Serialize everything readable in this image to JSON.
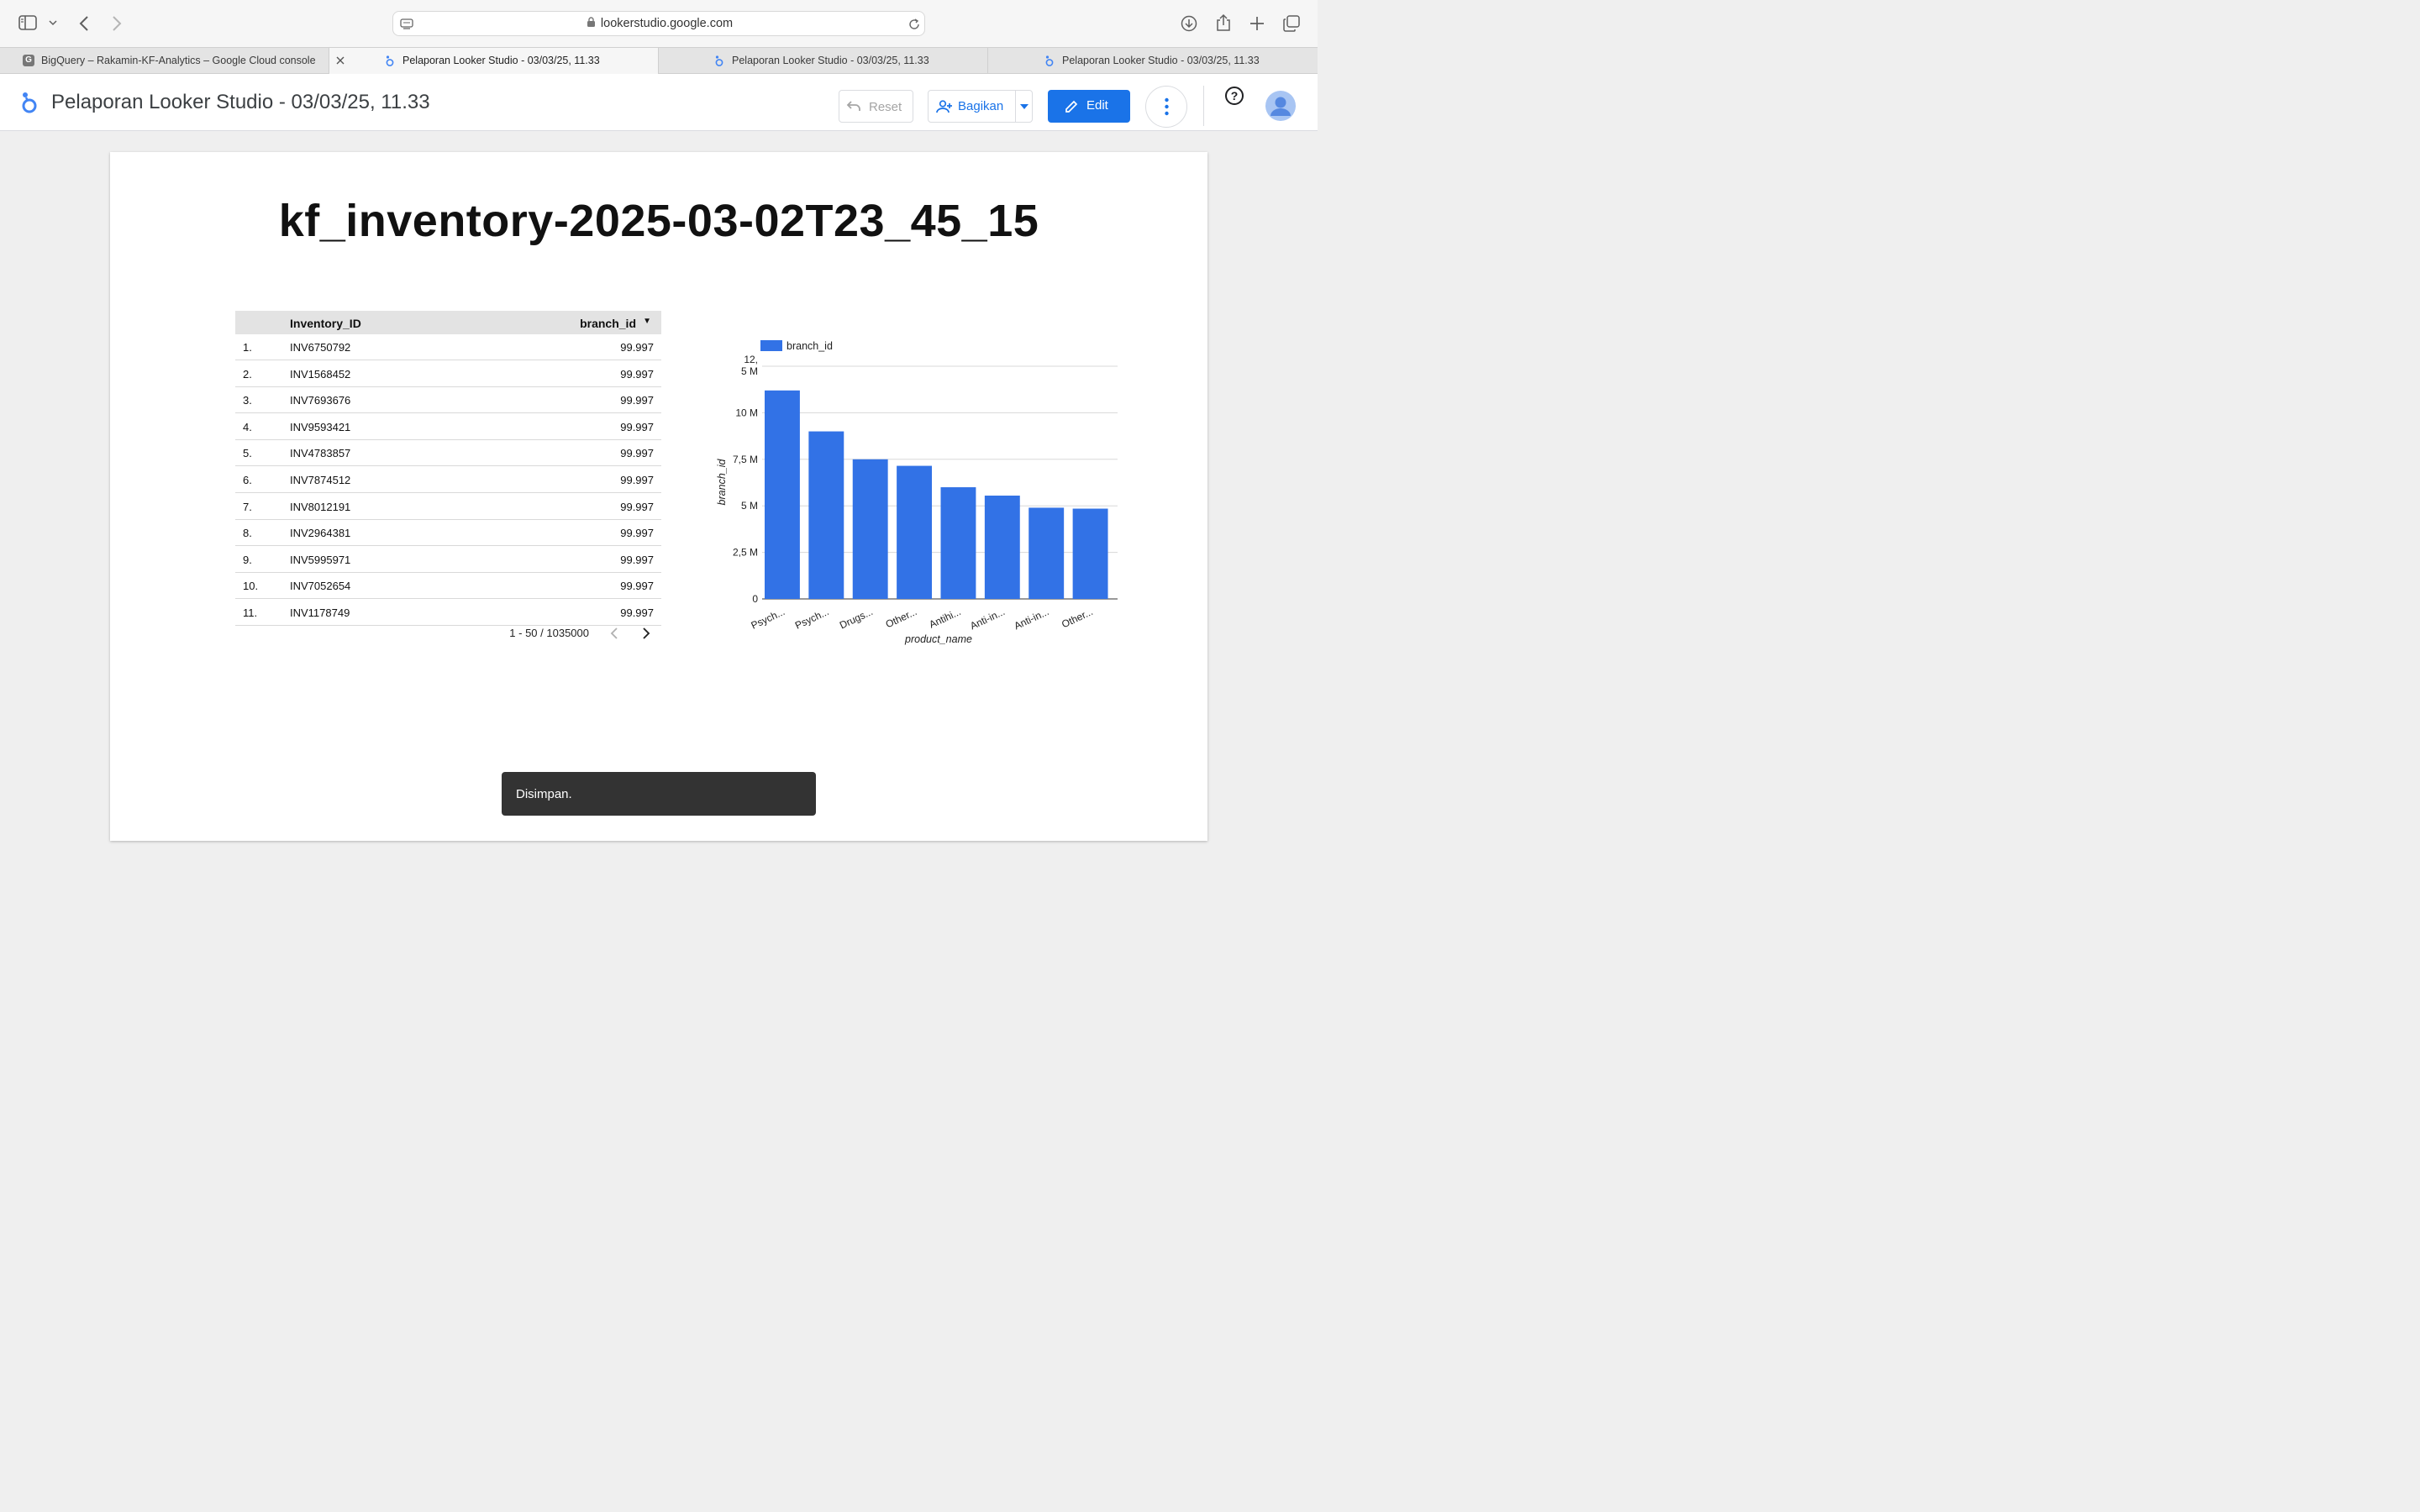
{
  "browser": {
    "url": "lookerstudio.google.com",
    "tabs": [
      {
        "label": "BigQuery – Rakamin-KF-Analytics – Google Cloud console",
        "favicon": "google-cloud-icon",
        "active": false
      },
      {
        "label": "Pelaporan Looker Studio - 03/03/25, 11.33",
        "favicon": "looker-studio-icon",
        "active": true
      },
      {
        "label": "Pelaporan Looker Studio - 03/03/25, 11.33",
        "favicon": "looker-studio-icon",
        "active": false
      },
      {
        "label": "Pelaporan Looker Studio - 03/03/25, 11.33",
        "favicon": "looker-studio-icon",
        "active": false
      }
    ]
  },
  "header": {
    "title": "Pelaporan Looker Studio - 03/03/25, 11.33",
    "reset_label": "Reset",
    "share_label": "Bagikan",
    "edit_label": "Edit",
    "accent_color": "#1a73e8"
  },
  "report": {
    "title": "kf_inventory-2025-03-02T23_45_15",
    "table": {
      "columns": [
        "Inventory_ID",
        "branch_id"
      ],
      "sort_indicator": "▼",
      "rows": [
        {
          "n": "1.",
          "id": "INV6750792",
          "val": "99.997"
        },
        {
          "n": "2.",
          "id": "INV1568452",
          "val": "99.997"
        },
        {
          "n": "3.",
          "id": "INV7693676",
          "val": "99.997"
        },
        {
          "n": "4.",
          "id": "INV9593421",
          "val": "99.997"
        },
        {
          "n": "5.",
          "id": "INV4783857",
          "val": "99.997"
        },
        {
          "n": "6.",
          "id": "INV7874512",
          "val": "99.997"
        },
        {
          "n": "7.",
          "id": "INV8012191",
          "val": "99.997"
        },
        {
          "n": "8.",
          "id": "INV2964381",
          "val": "99.997"
        },
        {
          "n": "9.",
          "id": "INV5995971",
          "val": "99.997"
        },
        {
          "n": "10.",
          "id": "INV7052654",
          "val": "99.997"
        },
        {
          "n": "11.",
          "id": "INV1178749",
          "val": "99.997"
        }
      ],
      "pagination": "1 - 50 / 1035000"
    }
  },
  "chart_data": {
    "type": "bar",
    "categories": [
      "Psych...",
      "Psych...",
      "Drugs...",
      "Other...",
      "Antihi...",
      "Anti-in...",
      "Anti-in...",
      "Other..."
    ],
    "series": [
      {
        "name": "branch_id",
        "values": [
          11200000,
          9000000,
          7500000,
          7150000,
          6000000,
          5550000,
          4900000,
          4850000
        ]
      }
    ],
    "xlabel": "product_name",
    "ylabel": "branch_id",
    "yticks": [
      "0",
      "2,5 M",
      "5 M",
      "7,5 M",
      "10 M",
      "12,\n5 M"
    ],
    "ylim": [
      0,
      12500000
    ],
    "grid": true,
    "legend": "top-left",
    "color": "#3272e6"
  },
  "toast": {
    "text": "Disimpan."
  }
}
